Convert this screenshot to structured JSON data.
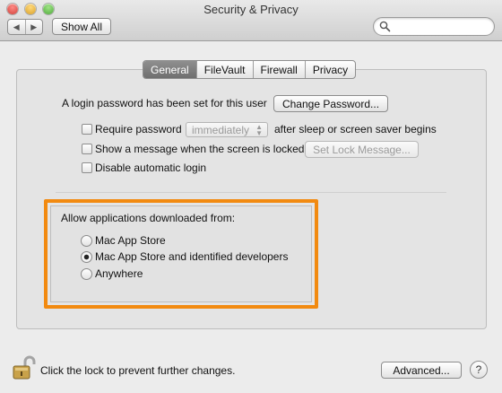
{
  "window": {
    "title": "Security & Privacy",
    "show_all_label": "Show All",
    "back_icon": "◀",
    "forward_icon": "▶",
    "search_placeholder": ""
  },
  "tabs": [
    {
      "label": "General",
      "active": true
    },
    {
      "label": "FileVault",
      "active": false
    },
    {
      "label": "Firewall",
      "active": false
    },
    {
      "label": "Privacy",
      "active": false
    }
  ],
  "general": {
    "login_password_text": "A login password has been set for this user",
    "change_password_label": "Change Password...",
    "require_password_label": "Require password",
    "require_password_option": "immediately",
    "require_password_suffix": "after sleep or screen saver begins",
    "show_message_label": "Show a message when the screen is locked",
    "set_lock_message_label": "Set Lock Message...",
    "disable_auto_login_label": "Disable automatic login"
  },
  "allow_apps": {
    "heading": "Allow applications downloaded from:",
    "options": [
      {
        "label": "Mac App Store",
        "selected": false
      },
      {
        "label": "Mac App Store and identified developers",
        "selected": true
      },
      {
        "label": "Anywhere",
        "selected": false
      }
    ]
  },
  "footer": {
    "lock_text": "Click the lock to prevent further changes.",
    "advanced_label": "Advanced...",
    "help_label": "?"
  },
  "colors": {
    "highlight": "#f28a10",
    "window_bg": "#ececec"
  }
}
